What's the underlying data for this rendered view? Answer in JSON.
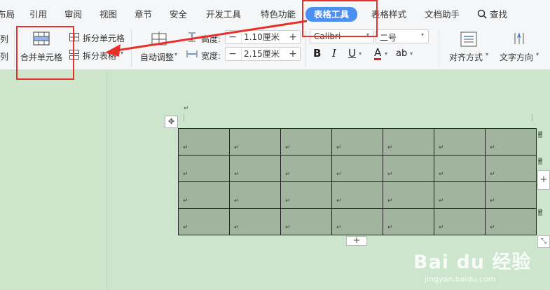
{
  "tabs": [
    "布局",
    "引用",
    "审阅",
    "视图",
    "章节",
    "安全",
    "开发工具",
    "特色功能",
    "表格工具",
    "表格样式",
    "文档助手"
  ],
  "search_label": "查找",
  "ribbon": {
    "col_left": "列",
    "merge_label": "合并单元格",
    "split_cell_label": "拆分单元格",
    "split_table_label": "拆分表格",
    "autofit_label": "自动调整",
    "height_label": "高度:",
    "height_value": "1.10厘米",
    "width_label": "宽度:",
    "width_value": "2.15厘米",
    "minus": "−",
    "plus": "+",
    "font_name": "Calibri",
    "font_size": "二号",
    "bold": "B",
    "italic": "I",
    "underline": "U",
    "fontcolor": "A",
    "highlight": "ab",
    "align_label": "对齐方式",
    "textdir_label": "文字方向"
  },
  "doc": {
    "para_mark": "↵",
    "move_glyph": "✥",
    "add_glyph": "+",
    "resize_glyph": "⤡"
  },
  "table": {
    "rows": 4,
    "cols": 7,
    "cell_mark": "↵"
  },
  "watermark": {
    "main": "Bai du 经验",
    "sub": "jingyan.baidu.com"
  },
  "colors": {
    "accent": "#4b8ff0",
    "highlight_box": "#e8302a",
    "table_fill": "#a1b59e",
    "page_bg": "#cde5cc"
  }
}
